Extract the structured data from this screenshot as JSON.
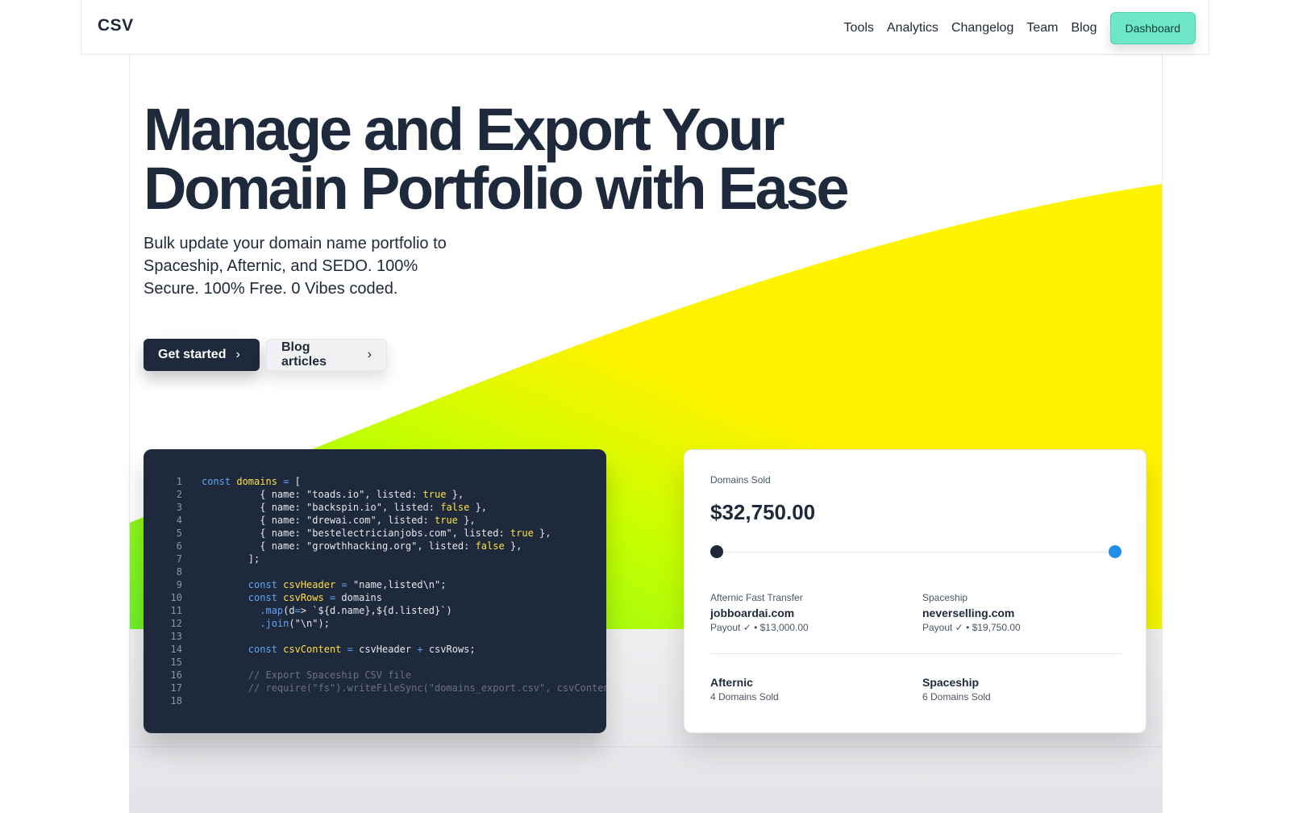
{
  "nav": {
    "logo": "CSV",
    "links": [
      "Tools",
      "Analytics",
      "Changelog",
      "Team",
      "Blog"
    ],
    "dashboard_label": "Dashboard"
  },
  "hero": {
    "title_line1": "Manage and Export Your",
    "title_line2": "Domain Portfolio with Ease",
    "subtitle": "Bulk update your domain name portfolio to Spaceship, Afternic, and SEDO. 100% Secure. 100% Free. 0 Vibes coded.",
    "primary_cta": "Get started",
    "secondary_cta": "Blog articles",
    "chevron": "›"
  },
  "code": {
    "lines": [
      "const domains = [",
      "          { name: \"toads.io\", listed: true },",
      "          { name: \"backspin.io\", listed: false },",
      "          { name: \"drewai.com\", listed: true },",
      "          { name: \"bestelectricianjobs.com\", listed: true },",
      "          { name: \"growthhacking.org\", listed: false },",
      "        ];",
      "",
      "        const csvHeader = \"name,listed\\n\";",
      "        const csvRows = domains",
      "          .map(d=> `${d.name},${d.listed}`)",
      "          .join(\"\\n\");",
      "",
      "        const csvContent = csvHeader + csvRows;",
      "",
      "        // Export Spaceship CSV file",
      "        // require(\"fs\").writeFileSync(\"domains_export.csv\", csvContent",
      ""
    ]
  },
  "stats": {
    "label": "Domains Sold",
    "amount": "$32,750.00",
    "sales": [
      {
        "source": "Afternic Fast Transfer",
        "domain": "jobboardai.com",
        "payout": "Payout ✓ • $13,000.00"
      },
      {
        "source": "Spaceship",
        "domain": "neverselling.com",
        "payout": "Payout ✓ • $19,750.00"
      }
    ],
    "marketplaces": [
      {
        "name": "Afternic",
        "count": "4 Domains Sold"
      },
      {
        "name": "Spaceship",
        "count": "6 Domains Sold"
      }
    ]
  },
  "colors": {
    "accent": "#6ee7c8",
    "dark": "#1e293b",
    "wave_green": "#7cf21e",
    "wave_yellow": "#fff200",
    "slider_blue": "#1e90ea"
  }
}
